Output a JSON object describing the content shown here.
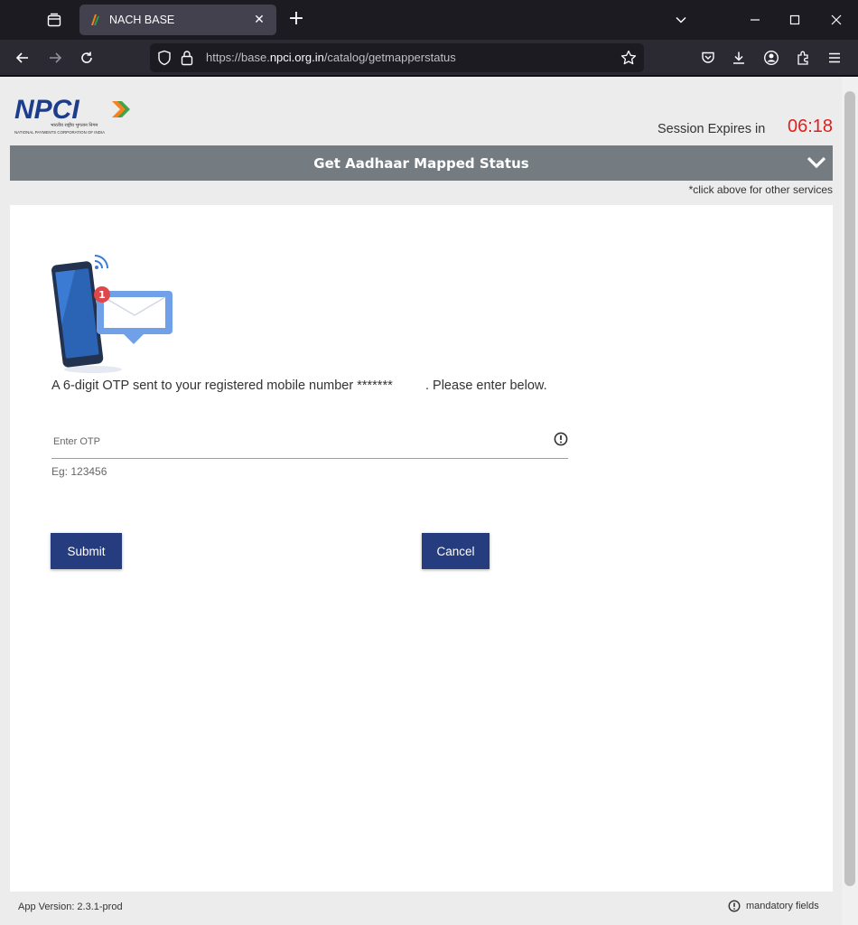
{
  "browser": {
    "tab_title": "NACH BASE",
    "url_prefix": "https://base.",
    "url_host": "npci.org.in",
    "url_path": "/catalog/getmapperstatus"
  },
  "header": {
    "logo_text": "NPCI",
    "logo_hindi": "भारतीय राष्ट्रीय भुगतान निगम",
    "logo_subtitle": "NATIONAL PAYMENTS CORPORATION OF INDIA",
    "session_label": "Session Expires in",
    "session_timer": "06:18"
  },
  "service": {
    "title": "Get Aadhaar Mapped Status",
    "hint": "*click above for other services"
  },
  "form": {
    "notification_badge": "1",
    "otp_message": "A 6-digit OTP sent to your registered mobile number *******         . Please enter below.",
    "otp_placeholder": "Enter OTP",
    "otp_value": "",
    "example": "Eg: 123456",
    "submit_label": "Submit",
    "cancel_label": "Cancel"
  },
  "footer": {
    "version": "App Version: 2.3.1-prod",
    "mandatory": "mandatory fields"
  },
  "colors": {
    "primary_button": "#253c7e",
    "service_bar": "#747c82",
    "timer": "#e21d1d"
  }
}
